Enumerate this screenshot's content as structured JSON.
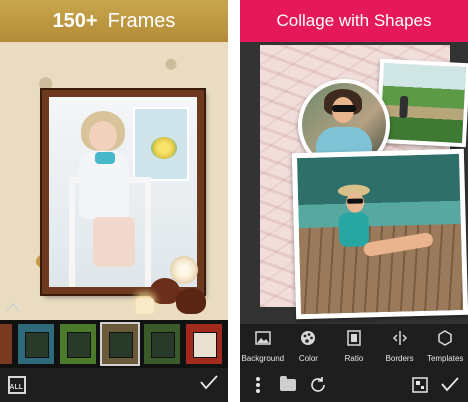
{
  "left_panel": {
    "banner": {
      "number": "150+",
      "title": "Frames"
    },
    "frame_thumbnails": [
      {
        "color": "#7a3a22"
      },
      {
        "color": "#2d6a7a"
      },
      {
        "color": "#4a7a2a"
      },
      {
        "color": "#6a5a3a",
        "selected": true
      },
      {
        "color": "#3a5a2a"
      },
      {
        "color": "#a12a1e"
      }
    ],
    "bottom_bar": {
      "all_label": "ALL"
    }
  },
  "right_panel": {
    "banner": {
      "title": "Collage with Shapes"
    },
    "tools": [
      {
        "icon": "image-icon",
        "label": "Background"
      },
      {
        "icon": "palette-icon",
        "label": "Color"
      },
      {
        "icon": "ratio-icon",
        "label": "Ratio"
      },
      {
        "icon": "borders-icon",
        "label": "Borders"
      },
      {
        "icon": "hexagon-icon",
        "label": "Templates"
      }
    ]
  },
  "colors": {
    "left_banner": "#b8913c",
    "right_banner": "#e5195a",
    "toolbar_bg": "#1e1e1e"
  }
}
